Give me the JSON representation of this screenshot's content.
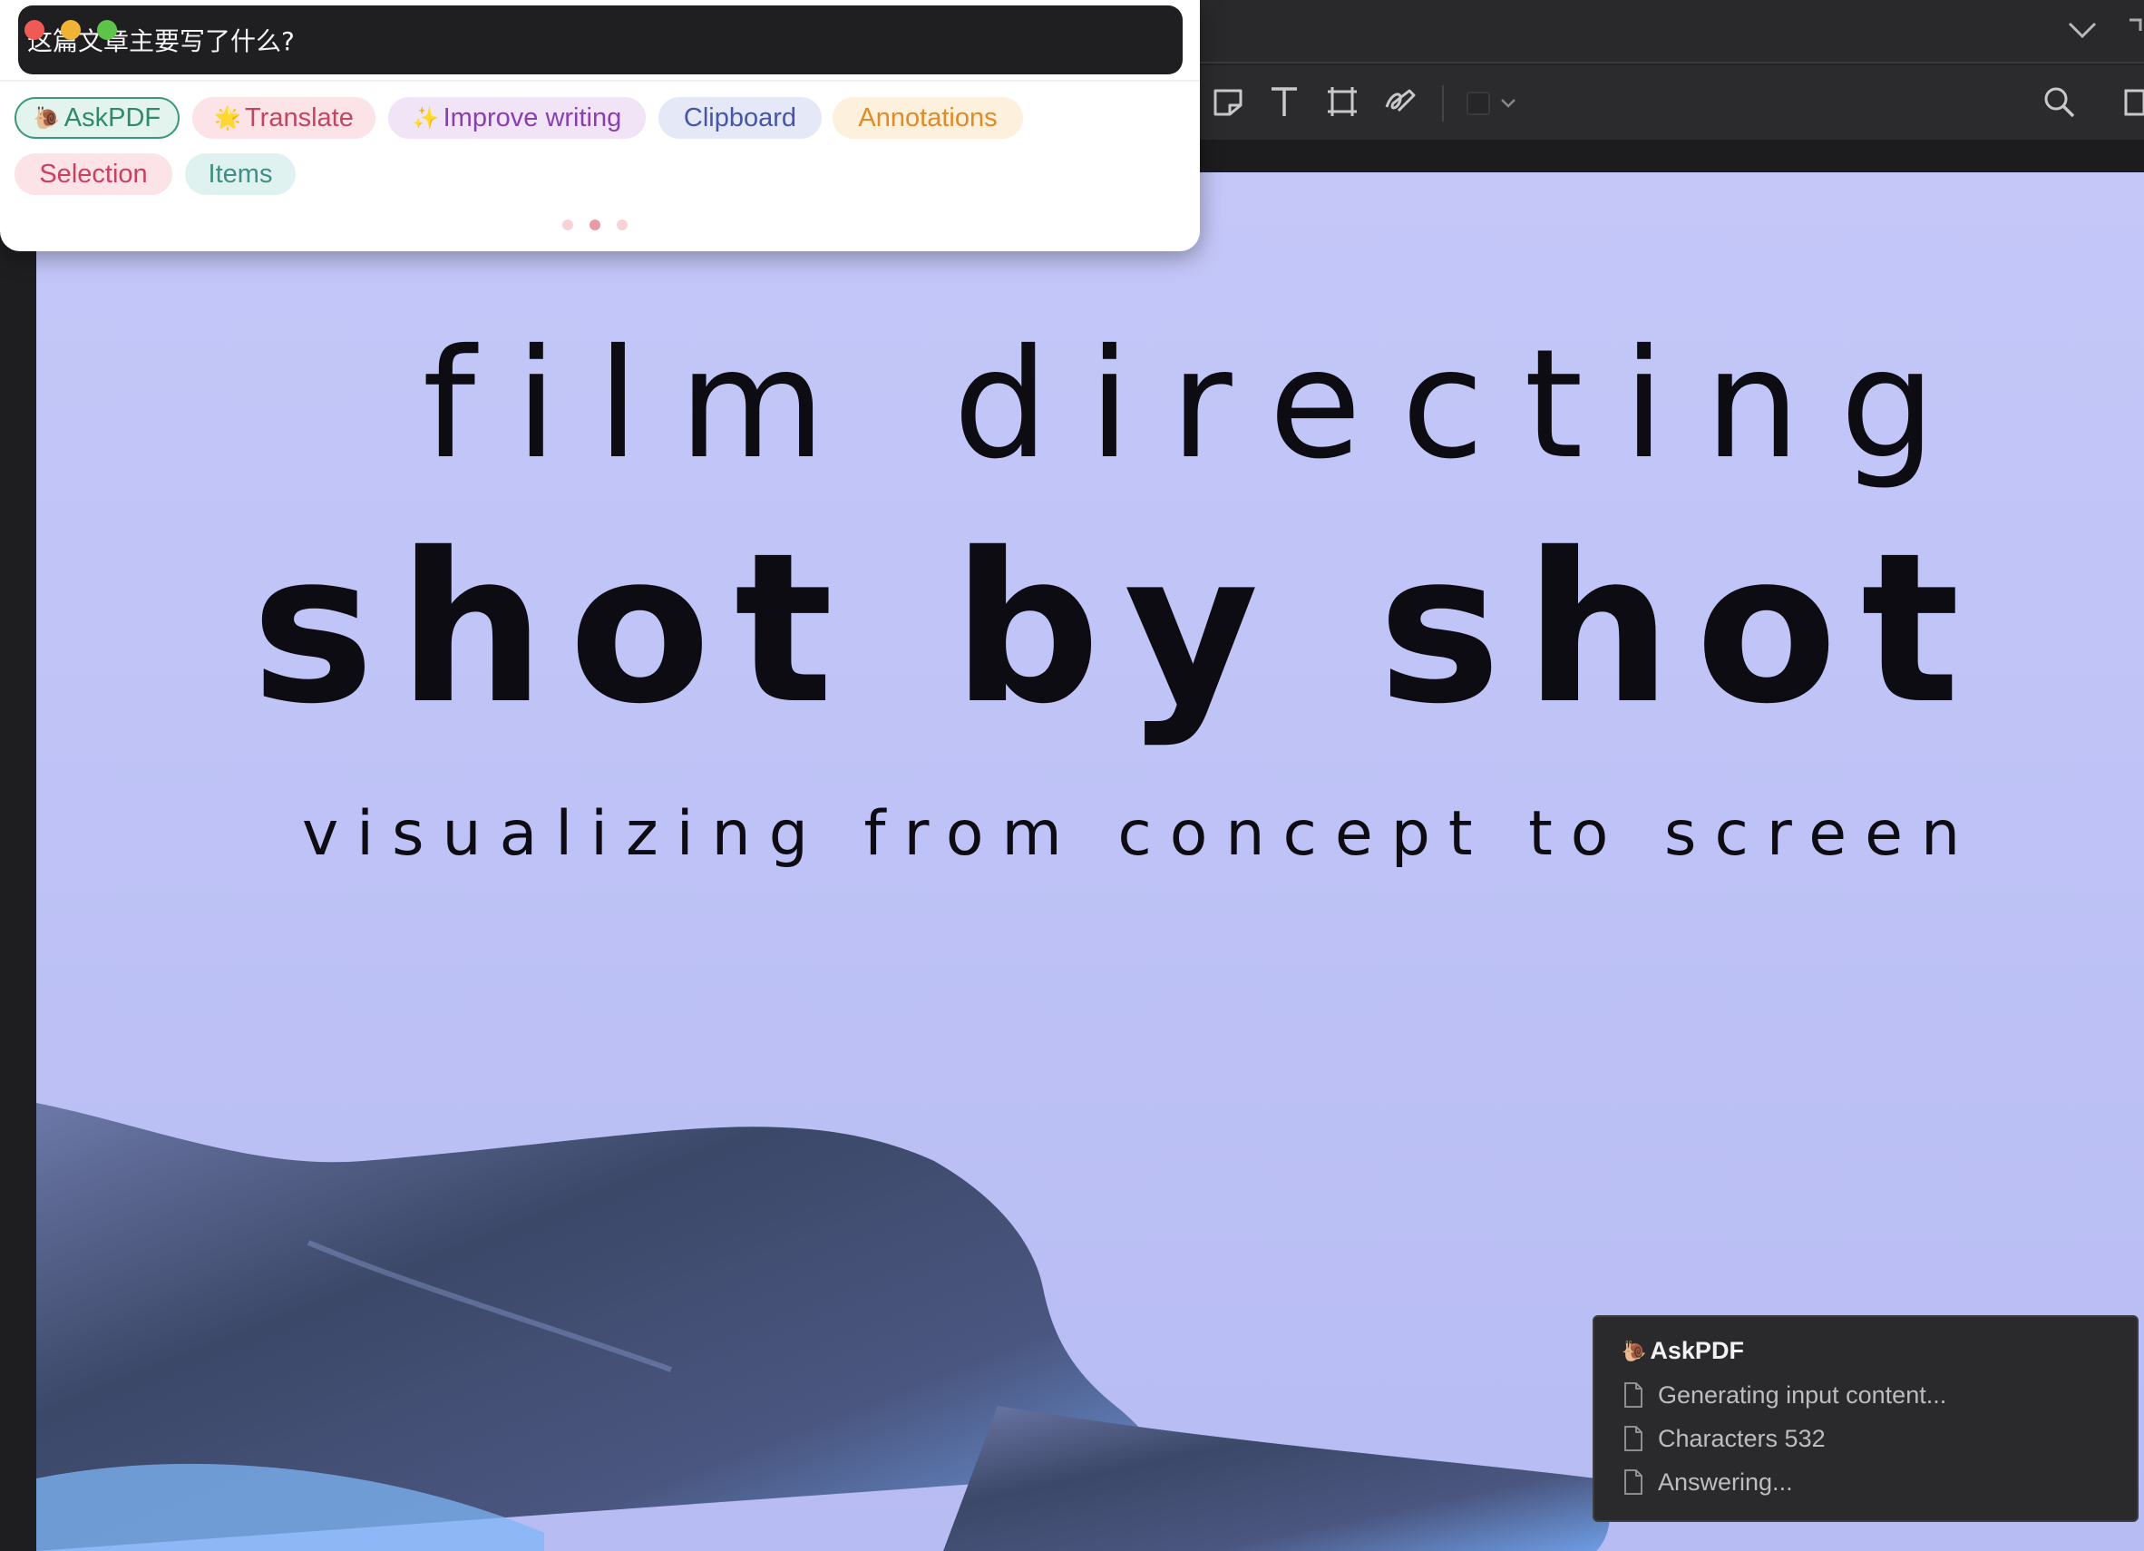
{
  "panel": {
    "query": "这篇文章主要写了什么?",
    "chips": [
      {
        "id": "askpdf",
        "icon": "🐌",
        "label": "AskPDF"
      },
      {
        "id": "translate",
        "icon": "🌟",
        "label": "Translate"
      },
      {
        "id": "improve",
        "icon": "✨",
        "label": "Improve writing"
      },
      {
        "id": "clipboard",
        "icon": "",
        "label": "Clipboard"
      },
      {
        "id": "annotations",
        "icon": "",
        "label": "Annotations"
      },
      {
        "id": "selection",
        "icon": "",
        "label": "Selection"
      },
      {
        "id": "items",
        "icon": "",
        "label": "Items"
      }
    ],
    "pager": {
      "count": 3,
      "active_index": 1
    }
  },
  "toolbar": {
    "icons": [
      "note-icon",
      "text-icon",
      "area-select-icon",
      "signature-icon",
      "color-swatch-icon",
      "search-icon",
      "sidebar-icon"
    ]
  },
  "cover": {
    "title": "film directing",
    "headline": "shot by shot",
    "subtitle": "visualizing from concept to screen"
  },
  "status": {
    "title_icon": "🐌",
    "title": "AskPDF",
    "rows": [
      "Generating input content...",
      "Characters 532",
      "Answering..."
    ]
  },
  "colors": {
    "cover_bg": "#c4c7f8",
    "panel_bg": "#ffffff",
    "query_bg": "#1f1f21",
    "status_bg": "#2a2a2c"
  }
}
